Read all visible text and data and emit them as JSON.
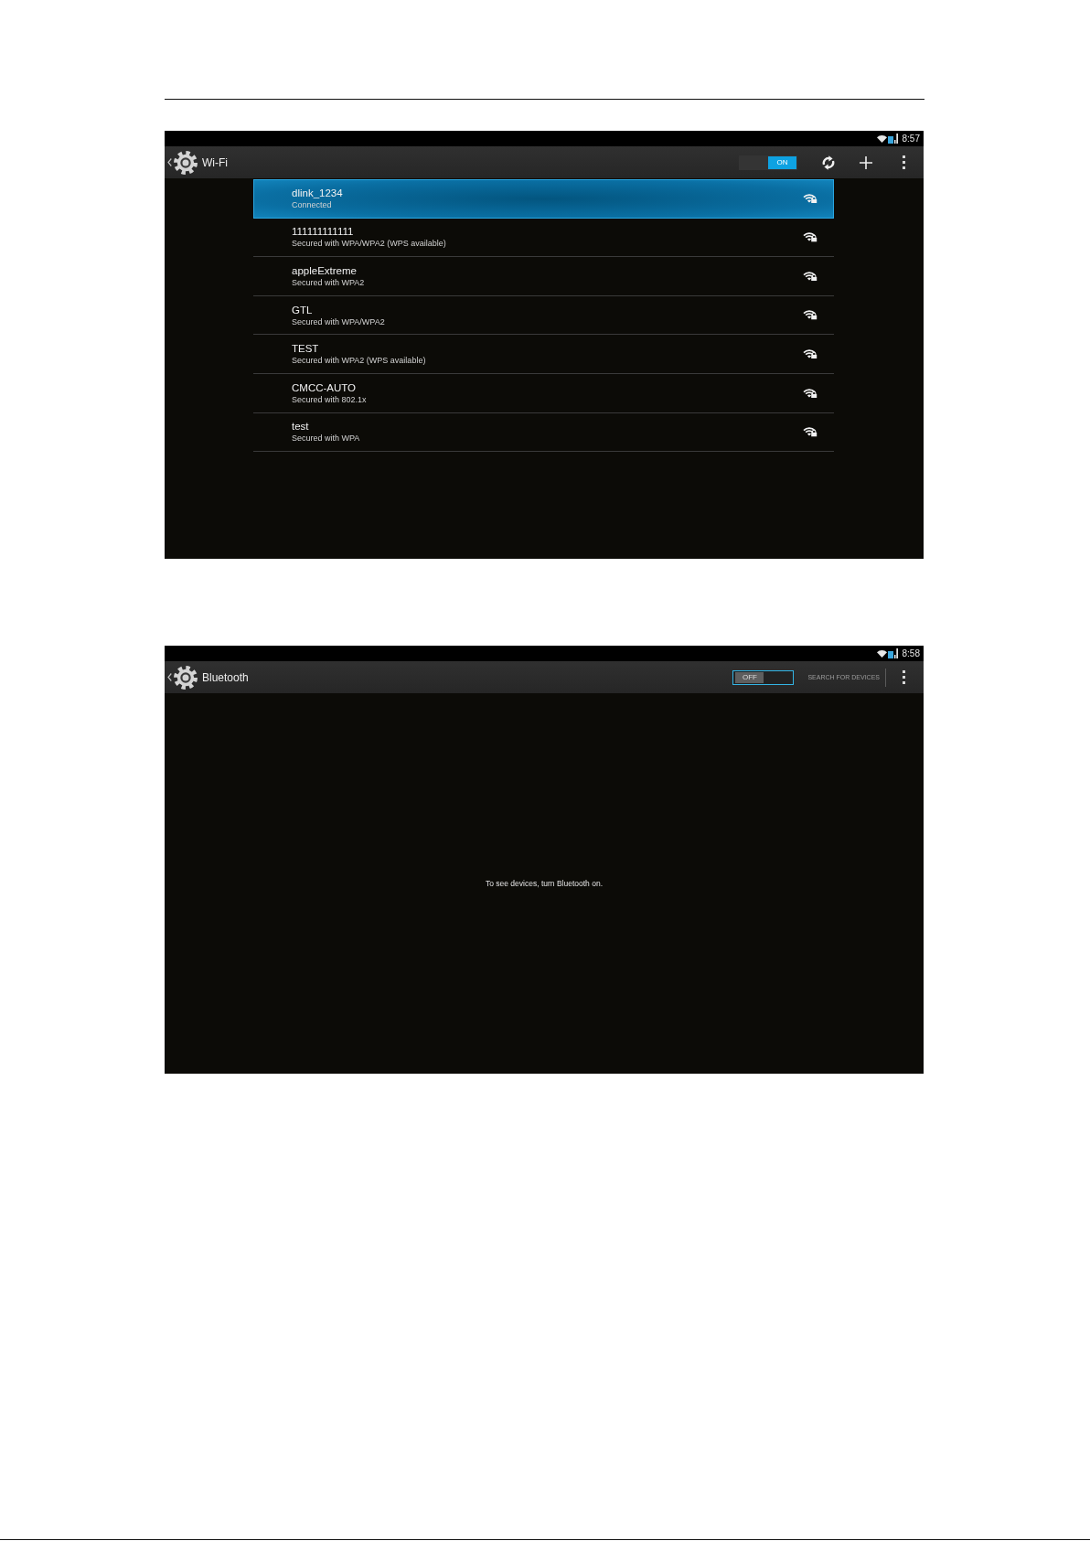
{
  "screens": [
    {
      "kind": "wifi",
      "status_bar": {
        "time": "8:57"
      },
      "action_bar": {
        "title": "Wi-Fi",
        "toggle": {
          "label": "ON",
          "on": true,
          "focused": false
        }
      },
      "networks": [
        {
          "name": "dlink_1234",
          "status": "Connected",
          "selected": true
        },
        {
          "name": "111111111111",
          "status": "Secured with WPA/WPA2 (WPS available)",
          "selected": false
        },
        {
          "name": "appleExtreme",
          "status": "Secured with WPA2",
          "selected": false
        },
        {
          "name": "GTL",
          "status": "Secured with WPA/WPA2",
          "selected": false
        },
        {
          "name": "TEST",
          "status": "Secured with WPA2 (WPS available)",
          "selected": false
        },
        {
          "name": "CMCC-AUTO",
          "status": "Secured with 802.1x",
          "selected": false
        },
        {
          "name": "test",
          "status": "Secured with WPA",
          "selected": false
        }
      ]
    },
    {
      "kind": "bluetooth",
      "status_bar": {
        "time": "8:58"
      },
      "action_bar": {
        "title": "Bluetooth",
        "toggle": {
          "label": "OFF",
          "on": false,
          "focused": true
        },
        "action": "SEARCH FOR DEVICES"
      },
      "message": "To see devices, turn Bluetooth on."
    }
  ]
}
